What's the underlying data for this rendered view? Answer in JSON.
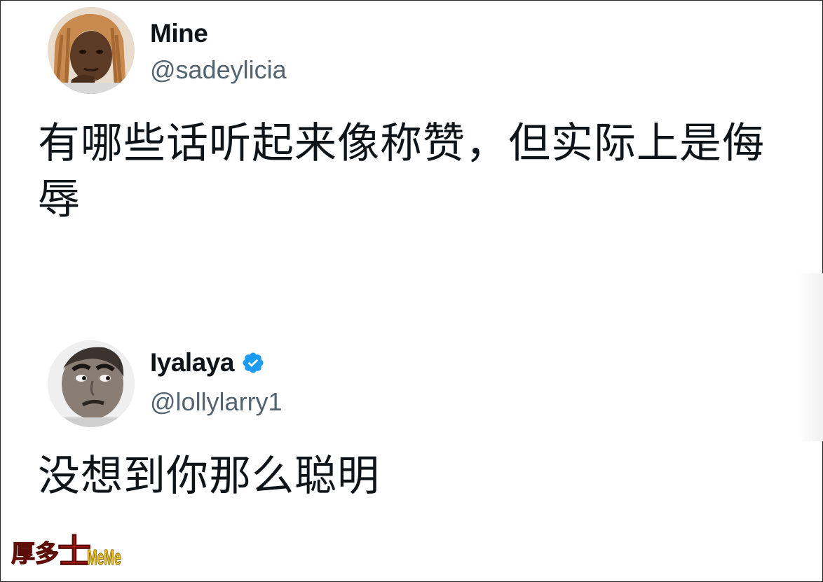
{
  "tweets": [
    {
      "display_name": "Mine",
      "handle": "@sadeylicia",
      "text": "有哪些话听起来像称赞，但实际上是侮辱",
      "verified": false
    },
    {
      "display_name": "Iyalaya",
      "handle": "@lollylarry1",
      "text": "没想到你那么聪明",
      "verified": true
    }
  ],
  "watermark": {
    "text_cn": "厚多士",
    "text_en": "MeMe"
  },
  "colors": {
    "handle": "#536471",
    "verified_badge": "#1d9bf0",
    "text": "#0f1419"
  }
}
